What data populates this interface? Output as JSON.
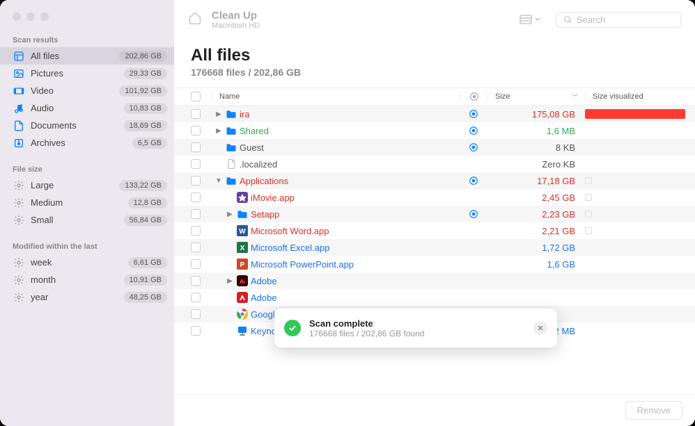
{
  "toolbar": {
    "title": "Clean Up",
    "subtitle": "Macintosh HD",
    "search_placeholder": "Search"
  },
  "header": {
    "title": "All files",
    "subtitle": "176668 files / 202,86 GB"
  },
  "columns": {
    "name": "Name",
    "size": "Size",
    "size_visualized": "Size visualized"
  },
  "sidebar": {
    "scan_results": {
      "title": "Scan results",
      "items": [
        {
          "icon": "content-icon",
          "label": "All files",
          "badge": "202,86 GB",
          "active": true,
          "color": "#0a84ff"
        },
        {
          "icon": "pictures-icon",
          "label": "Pictures",
          "badge": "29,33 GB",
          "active": false,
          "color": "#0a84ff"
        },
        {
          "icon": "video-icon",
          "label": "Video",
          "badge": "101,92 GB",
          "active": false,
          "color": "#0a84ff"
        },
        {
          "icon": "audio-icon",
          "label": "Audio",
          "badge": "10,83 GB",
          "active": false,
          "color": "#0a84ff"
        },
        {
          "icon": "documents-icon",
          "label": "Documents",
          "badge": "18,69 GB",
          "active": false,
          "color": "#0a84ff"
        },
        {
          "icon": "archives-icon",
          "label": "Archives",
          "badge": "6,5 GB",
          "active": false,
          "color": "#0a84ff"
        }
      ]
    },
    "file_size": {
      "title": "File size",
      "items": [
        {
          "icon": "gear-icon",
          "label": "Large",
          "badge": "133,22 GB",
          "color": "#999"
        },
        {
          "icon": "gear-icon",
          "label": "Medium",
          "badge": "12,8 GB",
          "color": "#999"
        },
        {
          "icon": "gear-icon",
          "label": "Small",
          "badge": "56,84 GB",
          "color": "#999"
        }
      ]
    },
    "modified": {
      "title": "Modified within the last",
      "items": [
        {
          "icon": "gear-icon",
          "label": "week",
          "badge": "6,61 GB",
          "color": "#999"
        },
        {
          "icon": "gear-icon",
          "label": "month",
          "badge": "10,91 GB",
          "color": "#999"
        },
        {
          "icon": "gear-icon",
          "label": "year",
          "badge": "48,25 GB",
          "color": "#999"
        }
      ]
    }
  },
  "files": [
    {
      "indent": 0,
      "disclosure": "closed",
      "icon": "folder",
      "icon_color": "#0a84ff",
      "name": "ira",
      "name_color": "red",
      "shared": true,
      "size": "175,08 GB",
      "size_color": "red",
      "viz_bar": 100,
      "viz_color": "#ff3b30"
    },
    {
      "indent": 0,
      "disclosure": "closed",
      "icon": "folder",
      "icon_color": "#0a84ff",
      "name": "Shared",
      "name_color": "green",
      "shared": true,
      "size": "1,6 MB",
      "size_color": "green"
    },
    {
      "indent": 0,
      "disclosure": "none",
      "icon": "folder",
      "icon_color": "#0a84ff",
      "name": "Guest",
      "name_color": "gray",
      "shared": true,
      "size": "8 KB",
      "size_color": "gray"
    },
    {
      "indent": 0,
      "disclosure": "none",
      "icon": "file",
      "icon_color": "#bbb",
      "name": ".localized",
      "name_color": "gray",
      "shared": false,
      "size": "Zero KB",
      "size_color": "gray"
    },
    {
      "indent": 0,
      "disclosure": "open",
      "icon": "folder",
      "icon_color": "#0a84ff",
      "name": "Applications",
      "name_color": "red",
      "shared": true,
      "size": "17,18 GB",
      "size_color": "red",
      "viz_box": true
    },
    {
      "indent": 1,
      "disclosure": "none",
      "icon": "imovie",
      "icon_color": "#a259ff",
      "name": "iMovie.app",
      "name_color": "red",
      "shared": false,
      "size": "2,45 GB",
      "size_color": "red",
      "viz_box": true
    },
    {
      "indent": 1,
      "disclosure": "closed",
      "icon": "folder",
      "icon_color": "#0a84ff",
      "name": "Setapp",
      "name_color": "red",
      "shared": true,
      "size": "2,23 GB",
      "size_color": "red",
      "viz_box": true
    },
    {
      "indent": 1,
      "disclosure": "none",
      "icon": "word",
      "icon_color": "#2b579a",
      "name": "Microsoft Word.app",
      "name_color": "red",
      "shared": false,
      "size": "2,21 GB",
      "size_color": "red",
      "viz_box": true
    },
    {
      "indent": 1,
      "disclosure": "none",
      "icon": "excel",
      "icon_color": "#217346",
      "name": "Microsoft Excel.app",
      "name_color": "blue",
      "shared": false,
      "size": "1,72 GB",
      "size_color": "blue"
    },
    {
      "indent": 1,
      "disclosure": "none",
      "icon": "powerpoint",
      "icon_color": "#d24726",
      "name": "Microsoft PowerPoint.app",
      "name_color": "blue",
      "shared": false,
      "size": "1,6 GB",
      "size_color": "blue"
    },
    {
      "indent": 1,
      "disclosure": "closed",
      "icon": "adobe-dark",
      "icon_color": "#2d0010",
      "name": "Adobe",
      "name_color": "blue",
      "shared": false,
      "size": "",
      "size_color": "blue"
    },
    {
      "indent": 1,
      "disclosure": "none",
      "icon": "adobe-red",
      "icon_color": "#d61f26",
      "name": "Adobe",
      "name_color": "blue",
      "shared": false,
      "size": "",
      "size_color": "blue"
    },
    {
      "indent": 1,
      "disclosure": "none",
      "icon": "chrome",
      "icon_color": "#fff",
      "name": "Googl",
      "name_color": "blue",
      "shared": false,
      "size": "",
      "size_color": "blue"
    },
    {
      "indent": 1,
      "disclosure": "none",
      "icon": "keynote",
      "icon_color": "#0a84ff",
      "name": "Keynote.app",
      "name_color": "blue",
      "shared": false,
      "size": "594,2 MB",
      "size_color": "blue"
    }
  ],
  "toast": {
    "title": "Scan complete",
    "subtitle": "176668 files / 202,86 GB found"
  },
  "footer": {
    "remove": "Remove"
  }
}
